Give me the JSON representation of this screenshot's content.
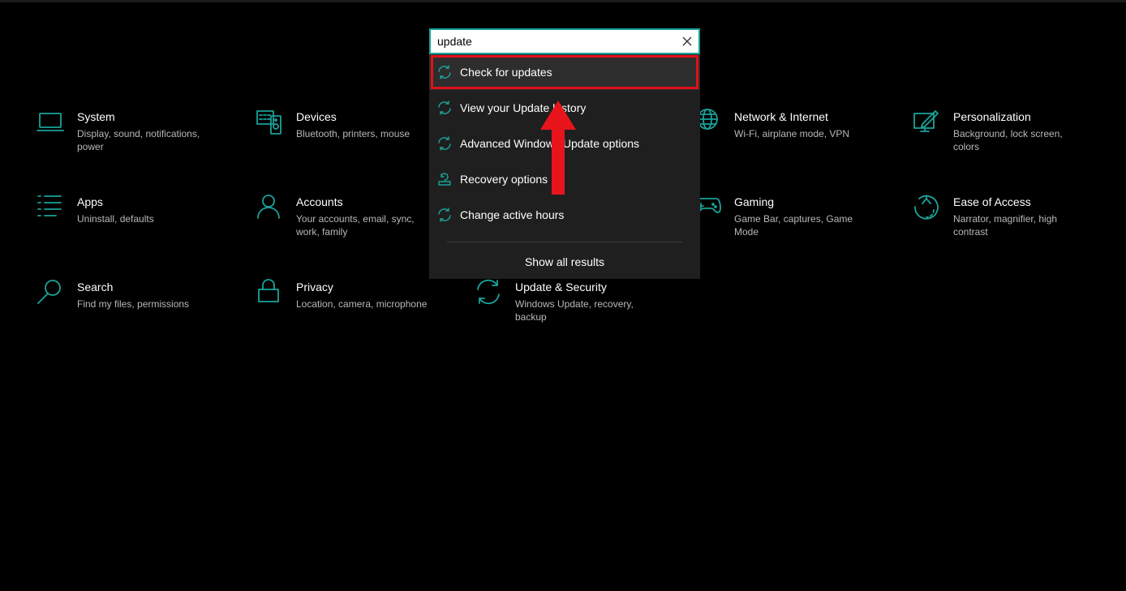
{
  "search": {
    "value": "update",
    "results": [
      {
        "label": "Check for updates",
        "icon": "refresh-icon",
        "selected": true
      },
      {
        "label": "View your Update history",
        "icon": "refresh-icon"
      },
      {
        "label": "Advanced Windows Update options",
        "icon": "refresh-icon"
      },
      {
        "label": "Recovery options",
        "icon": "recovery-icon"
      },
      {
        "label": "Change active hours",
        "icon": "refresh-icon"
      }
    ],
    "show_all": "Show all results"
  },
  "tiles": [
    {
      "title": "System",
      "desc": "Display, sound, notifications, power",
      "icon": "laptop-icon"
    },
    {
      "title": "Devices",
      "desc": "Bluetooth, printers, mouse",
      "icon": "devices-icon"
    },
    {
      "title": "Network & Internet",
      "desc": "Wi-Fi, airplane mode, VPN",
      "icon": "globe-icon"
    },
    {
      "title": "Personalization",
      "desc": "Background, lock screen, colors",
      "icon": "paint-icon"
    },
    {
      "title": "Apps",
      "desc": "Uninstall, defaults",
      "icon": "apps-list-icon"
    },
    {
      "title": "Accounts",
      "desc": "Your accounts, email, sync, work, family",
      "icon": "person-icon"
    },
    {
      "title": "Gaming",
      "desc": "Game Bar, captures, Game Mode",
      "icon": "gamepad-icon"
    },
    {
      "title": "Ease of Access",
      "desc": "Narrator, magnifier, high contrast",
      "icon": "ease-of-access-icon"
    },
    {
      "title": "Search",
      "desc": "Find my files, permissions",
      "icon": "search-icon"
    },
    {
      "title": "Privacy",
      "desc": "Location, camera, microphone",
      "icon": "lock-icon"
    },
    {
      "title": "Update & Security",
      "desc": "Windows Update, recovery, backup",
      "icon": "refresh-icon"
    }
  ],
  "colors": {
    "accent": "#1aa39a",
    "highlight": "#e0101a",
    "background": "#000000",
    "dropdown": "#1f1f1f"
  }
}
